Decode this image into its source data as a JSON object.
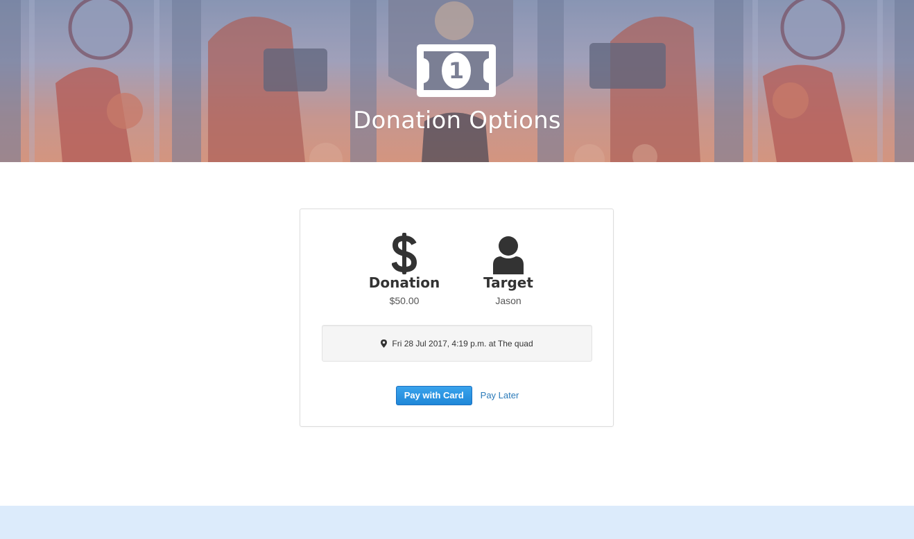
{
  "header": {
    "title": "Donation Options",
    "icon": "money-bill-icon",
    "bill_value": "1"
  },
  "summary": {
    "donation": {
      "icon": "dollar-icon",
      "label": "Donation",
      "value": "$50.00"
    },
    "target": {
      "icon": "user-icon",
      "label": "Target",
      "value": "Jason"
    }
  },
  "event": {
    "icon": "map-marker-icon",
    "text": "Fri 28 Jul 2017, 4:19 p.m. at The quad"
  },
  "actions": {
    "pay_card_label": "Pay with Card",
    "pay_later_label": "Pay Later"
  },
  "colors": {
    "primary_button": "#1f87d8",
    "link": "#2a7ab9",
    "footer": "#dcebfb"
  }
}
